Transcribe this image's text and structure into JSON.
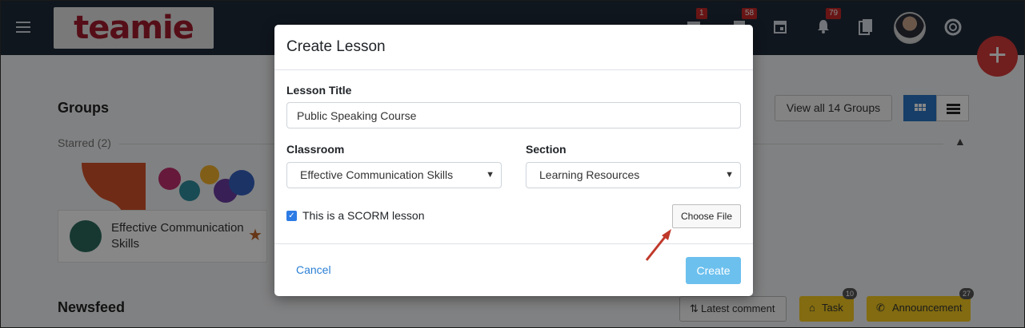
{
  "topbar": {
    "logo_text": "teamie",
    "badges": {
      "messages": "1",
      "notifications_files": "58",
      "alerts": "79"
    },
    "icons": [
      "menu-icon",
      "mail-icon",
      "files-icon",
      "calendar-icon",
      "bell-icon",
      "documents-icon",
      "help-icon"
    ]
  },
  "groups": {
    "title": "Groups",
    "view_all_label": "View all 14 Groups",
    "starred_label": "Starred (2)",
    "card": {
      "name": "Effective Communication Skills"
    }
  },
  "newsfeed": {
    "title": "Newsfeed",
    "filters": [
      {
        "label": "Latest comment",
        "icon": "sort-icon"
      },
      {
        "label": "Task",
        "icon": "home-icon",
        "count": "10"
      },
      {
        "label": "Announcement",
        "icon": "megaphone-icon",
        "count": "27"
      }
    ]
  },
  "modal": {
    "title": "Create Lesson",
    "lesson_title_label": "Lesson Title",
    "lesson_title_value": "Public Speaking Course",
    "classroom_label": "Classroom",
    "classroom_value": "Effective Communication Skills",
    "section_label": "Section",
    "section_value": "Learning Resources",
    "scorm_checked": true,
    "scorm_label": "This is a SCORM lesson",
    "choose_file_label": "Choose File",
    "cancel_label": "Cancel",
    "create_label": "Create"
  },
  "colors": {
    "topbar": "#1f2b3a",
    "accent": "#2a7fd4",
    "create_button": "#6cc0ee",
    "fab": "#d63a3a",
    "arrow": "#c0392b",
    "filter_yellow": "#f5cb1f"
  }
}
